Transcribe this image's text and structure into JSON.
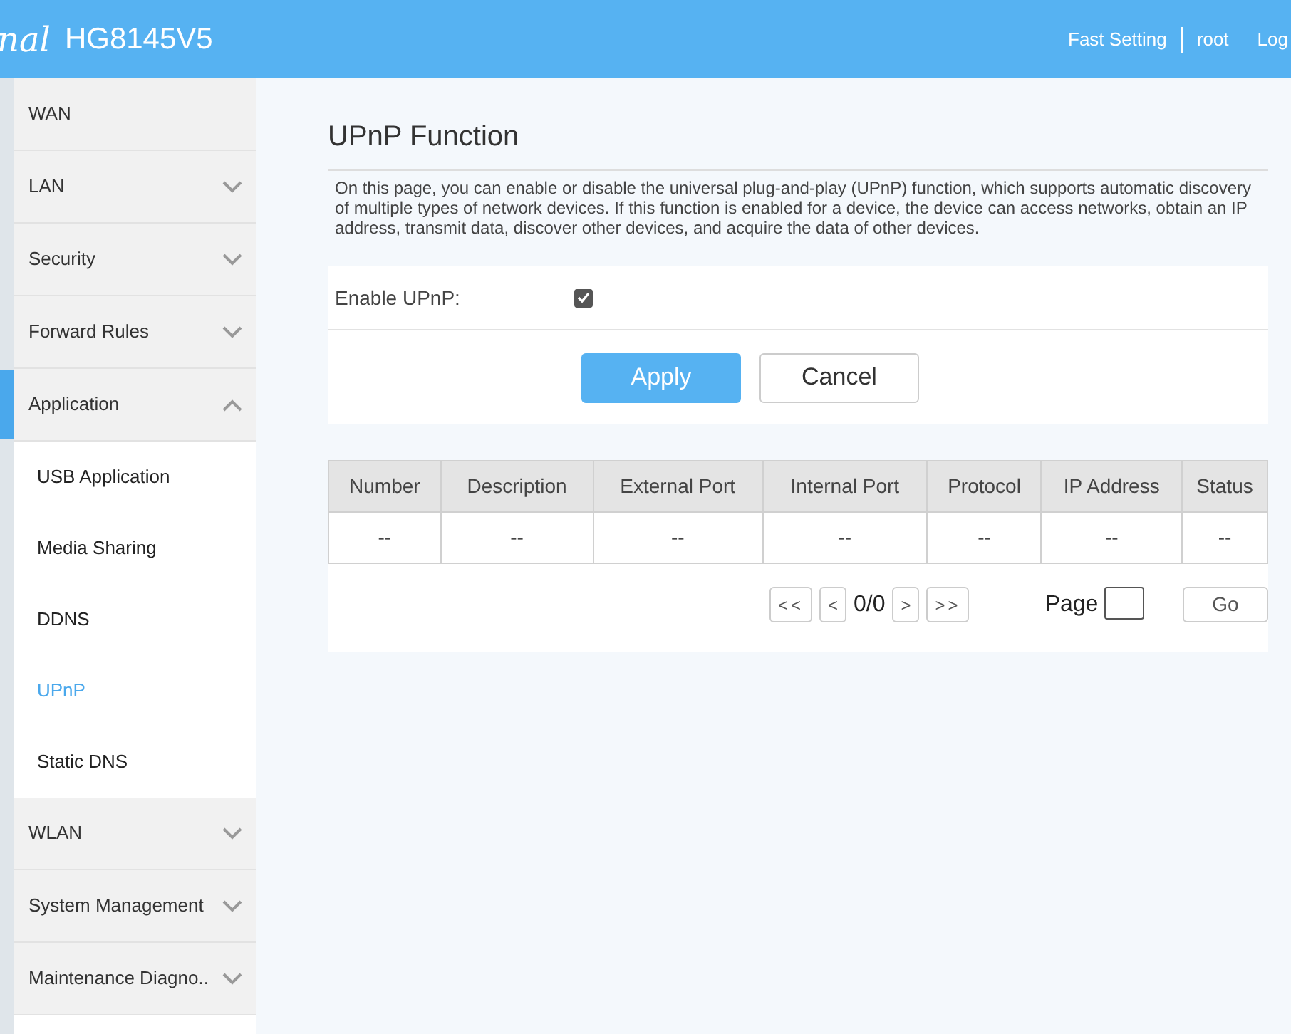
{
  "header": {
    "logo": "nal",
    "model": "HG8145V5",
    "links": [
      "Fast Setting",
      "root",
      "Log"
    ]
  },
  "sidebar": {
    "items": [
      {
        "label": "WAN",
        "expandable": false,
        "selected": false
      },
      {
        "label": "LAN",
        "expandable": true,
        "expanded": false,
        "selected": false
      },
      {
        "label": "Security",
        "expandable": true,
        "expanded": false,
        "selected": false
      },
      {
        "label": "Forward Rules",
        "expandable": true,
        "expanded": false,
        "selected": false
      },
      {
        "label": "Application",
        "expandable": true,
        "expanded": true,
        "selected": true,
        "children": [
          {
            "label": "USB Application",
            "selected": false
          },
          {
            "label": "Media Sharing",
            "selected": false
          },
          {
            "label": "DDNS",
            "selected": false
          },
          {
            "label": "UPnP",
            "selected": true
          },
          {
            "label": "Static DNS",
            "selected": false
          }
        ]
      },
      {
        "label": "WLAN",
        "expandable": true,
        "expanded": false,
        "selected": false
      },
      {
        "label": "System Management",
        "expandable": true,
        "expanded": false,
        "selected": false
      },
      {
        "label": "Maintenance Diagno..",
        "expandable": true,
        "expanded": false,
        "selected": false
      }
    ]
  },
  "page": {
    "title": "UPnP Function",
    "description": "On this page, you can enable or disable the universal plug-and-play (UPnP) function, which supports automatic discovery of multiple types of network devices. If this function is enabled for a device, the device can access networks, obtain an IP address, transmit data, discover other devices, and acquire the data of other devices.",
    "enable": {
      "label": "Enable UPnP:",
      "checked": true
    },
    "buttons": [
      "Apply",
      "Cancel"
    ]
  },
  "table": {
    "columns": [
      "Number",
      "Description",
      "External Port",
      "Internal Port",
      "Protocol",
      "IP Address",
      "Status"
    ],
    "rows": [
      [
        "--",
        "--",
        "--",
        "--",
        "--",
        "--",
        "--"
      ]
    ]
  },
  "pager": {
    "first": "<<",
    "prev": "<",
    "count": "0/0",
    "next": ">",
    "last": ">>",
    "page_label": "Page",
    "go": "Go"
  }
}
